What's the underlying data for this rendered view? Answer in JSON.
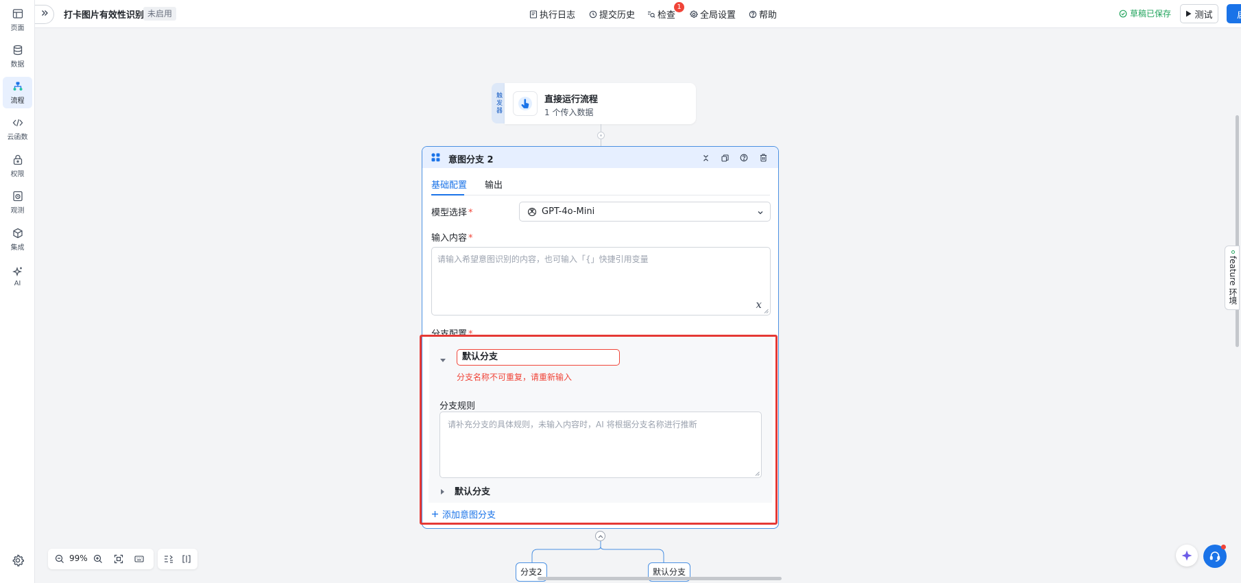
{
  "rail": {
    "items": [
      {
        "label": "页面",
        "icon": "page-layout-icon"
      },
      {
        "label": "数据",
        "icon": "database-icon"
      },
      {
        "label": "流程",
        "icon": "flow-icon",
        "active": true
      },
      {
        "label": "云函数",
        "icon": "code-icon"
      },
      {
        "label": "权限",
        "icon": "lock-icon"
      },
      {
        "label": "观测",
        "icon": "monitor-icon"
      },
      {
        "label": "集成",
        "icon": "cube-icon"
      },
      {
        "label": "AI",
        "icon": "sparkle-icon"
      }
    ],
    "settings_icon": "gear-icon"
  },
  "header": {
    "app_title": "打卡图片有效性识别",
    "status_tag": "未启用",
    "nav": {
      "logs": "执行日志",
      "history": "提交历史",
      "check": "检查",
      "check_badge": "1",
      "settings": "全局设置",
      "help": "帮助"
    },
    "saved_text": "草稿已保存",
    "test_label": "测试",
    "enable_label": "启用"
  },
  "trigger": {
    "tag": "触发器",
    "title": "直接运行流程",
    "subtitle": "1 个传入数据"
  },
  "node": {
    "title": "意图分支 2",
    "tabs": {
      "config": "基础配置",
      "output": "输出"
    },
    "model_label": "模型选择",
    "model_value": "GPT-4o-Mini",
    "input_label": "输入内容",
    "input_placeholder": "请输入希望意图识别的内容，也可输入「{」快捷引用变量",
    "branch_config_label": "分支配置",
    "branch_expanded": {
      "name": "默认分支",
      "error": "分支名称不可重复，请重新输入",
      "rule_label": "分支规则",
      "rule_placeholder": "请补充分支的具体规则，未输入内容时，AI 将根据分支名称进行推断"
    },
    "branch_collapsed": {
      "name": "默认分支"
    },
    "add_branch": "添加意图分支"
  },
  "branches_below": [
    "分支2",
    "默认分支"
  ],
  "zoom": {
    "level": "99%"
  },
  "feature_tab": "feature 环境",
  "colors": {
    "accent": "#1a73e8",
    "error": "#f04438",
    "saved": "#22a45d",
    "highlight": "#e53935"
  }
}
